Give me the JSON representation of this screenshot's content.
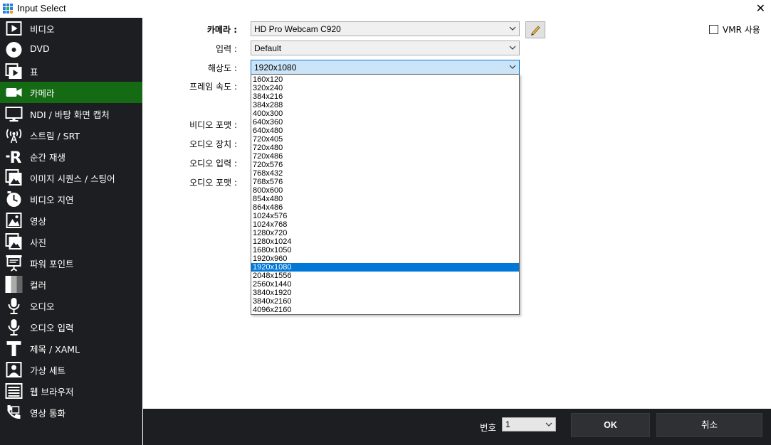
{
  "window": {
    "title": "Input Select"
  },
  "sidebar": {
    "items": [
      {
        "label": "비디오",
        "icon": "video-icon"
      },
      {
        "label": "DVD",
        "icon": "dvd-icon"
      },
      {
        "label": "표",
        "icon": "list-icon"
      },
      {
        "label": "카메라",
        "icon": "camera-icon",
        "active": true
      },
      {
        "label": "NDI / 바탕 화면 캡처",
        "icon": "monitor-icon"
      },
      {
        "label": "스트림 / SRT",
        "icon": "antenna-icon"
      },
      {
        "label": "순간 재생",
        "icon": "replay-icon"
      },
      {
        "label": "이미지 시퀀스 / 스팅어",
        "icon": "image-sequence-icon"
      },
      {
        "label": "비디오 지연",
        "icon": "clock-icon"
      },
      {
        "label": "영상",
        "icon": "image-icon"
      },
      {
        "label": "사진",
        "icon": "photos-icon"
      },
      {
        "label": "파워 포인트",
        "icon": "presentation-icon"
      },
      {
        "label": "컬러",
        "icon": "color-icon"
      },
      {
        "label": "오디오",
        "icon": "microphone-icon"
      },
      {
        "label": "오디오 입력",
        "icon": "microphone-input-icon"
      },
      {
        "label": "제목 / XAML",
        "icon": "title-icon"
      },
      {
        "label": "가상 세트",
        "icon": "virtual-set-icon"
      },
      {
        "label": "웹 브라우저",
        "icon": "web-browser-icon"
      },
      {
        "label": "영상 통화",
        "icon": "video-call-icon"
      }
    ]
  },
  "form": {
    "camera_label": "카메라 :",
    "camera_value": "HD Pro Webcam C920",
    "input_label": "입력 :",
    "input_value": "Default",
    "resolution_label": "해상도 :",
    "resolution_value": "1920x1080",
    "framerate_label": "프레임 속도 :",
    "video_format_label": "비디오 포맷 :",
    "audio_device_label": "오디오 장치 :",
    "audio_input_label": "오디오 입력 :",
    "audio_format_label": "오디오 포맷 :",
    "vmr_label": "VMR 사용",
    "vmr_checked": false
  },
  "resolution_options": [
    "160x120",
    "320x240",
    "384x216",
    "384x288",
    "400x300",
    "640x360",
    "640x480",
    "720x405",
    "720x480",
    "720x486",
    "720x576",
    "768x432",
    "768x576",
    "800x600",
    "854x480",
    "864x486",
    "1024x576",
    "1024x768",
    "1280x720",
    "1280x1024",
    "1680x1050",
    "1920x960",
    "1920x1080",
    "2048x1556",
    "2560x1440",
    "3840x1920",
    "3840x2160",
    "4096x2160"
  ],
  "resolution_selected_index": 22,
  "bottom": {
    "number_label": "번호",
    "number_value": "1",
    "ok_label": "OK",
    "cancel_label": "취소"
  },
  "colors": {
    "sidebar_bg": "#1d1e21",
    "active_bg": "#146b14",
    "selection": "#0078d7"
  }
}
